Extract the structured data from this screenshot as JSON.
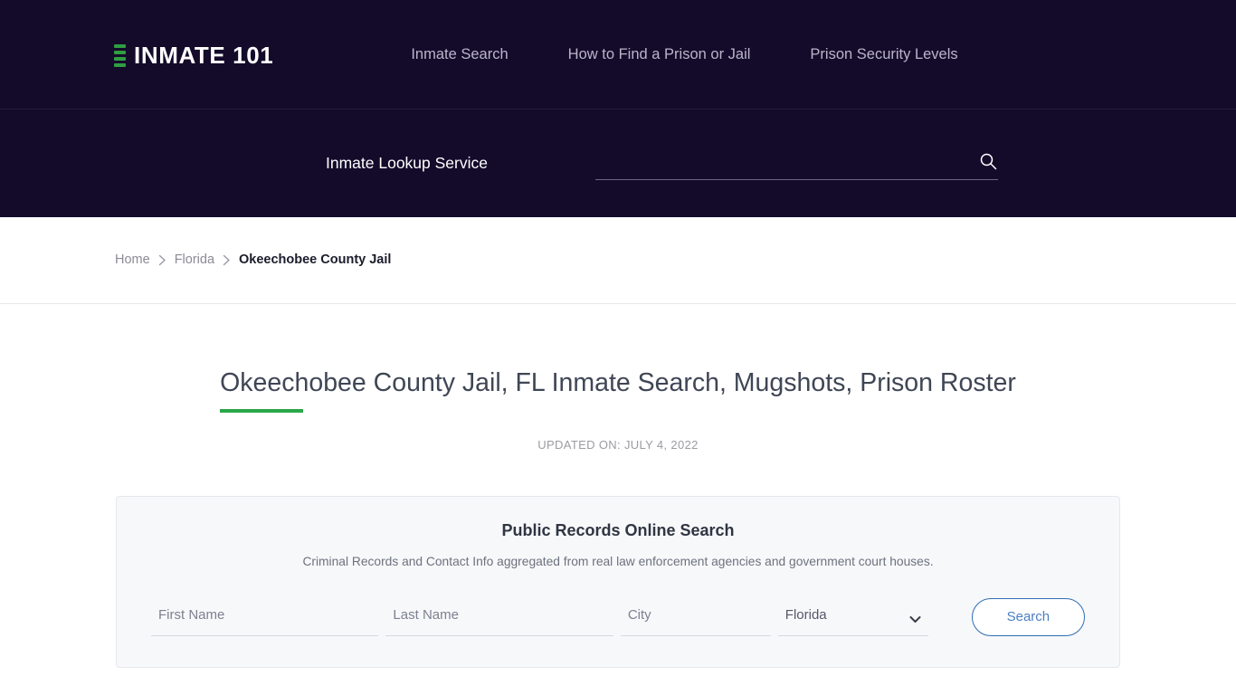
{
  "header": {
    "brand": {
      "text": "INMATE 101",
      "mark_color": "#2f9e41",
      "bar_count": 4
    },
    "nav": [
      {
        "label": "Inmate Search"
      },
      {
        "label": "How to Find a Prison or Jail"
      },
      {
        "label": "Prison Security Levels"
      }
    ],
    "background_color": "#140b2b"
  },
  "lookup": {
    "label": "Inmate Lookup Service",
    "search_value": "",
    "search_placeholder": "",
    "search_icon": "search-icon"
  },
  "breadcrumb": {
    "items": [
      {
        "label": "Home",
        "current": false
      },
      {
        "label": "Florida",
        "current": false
      },
      {
        "label": "Okeechobee County Jail",
        "current": true
      }
    ],
    "separator_icon": "chevron-right-icon"
  },
  "page": {
    "title": "Okeechobee County Jail, FL Inmate Search, Mugshots, Prison Roster",
    "accent_color": "#2ba749",
    "updated_on": "UPDATED ON: JULY 4, 2022"
  },
  "records_panel": {
    "title": "Public Records Online Search",
    "subtitle": "Criminal Records and Contact Info aggregated from real law enforcement agencies and government court houses.",
    "fields": {
      "first_name": {
        "placeholder": "First Name",
        "value": ""
      },
      "last_name": {
        "placeholder": "Last Name",
        "value": ""
      },
      "city": {
        "placeholder": "City",
        "value": ""
      },
      "state": {
        "selected": "Florida",
        "options": [
          "Florida"
        ]
      }
    },
    "submit_label": "Search",
    "submit_color": "#4a7fc1",
    "background_color": "#f7f8fa"
  }
}
